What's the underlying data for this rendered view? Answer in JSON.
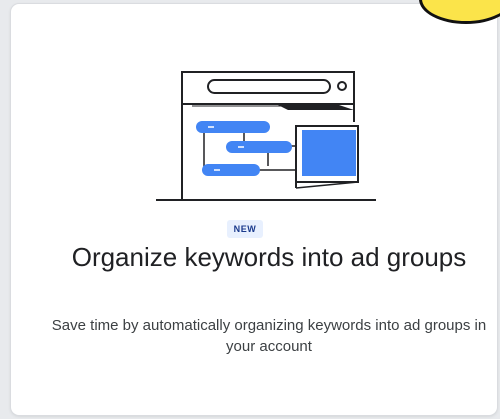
{
  "card": {
    "badge": "NEW",
    "title": "Organize keywords into ad groups",
    "description": "Save time by automatically organizing keywords into ad groups in your account"
  },
  "colors": {
    "accent_blue": "#4285f4",
    "badge_background": "#e8f0fe",
    "badge_text": "#1a3a8c",
    "title_text": "#202124",
    "body_text": "#3c4043",
    "corner_yellow": "#fbe44a"
  },
  "icons": {
    "illustration": "keyword-organizer-illustration-icon"
  }
}
